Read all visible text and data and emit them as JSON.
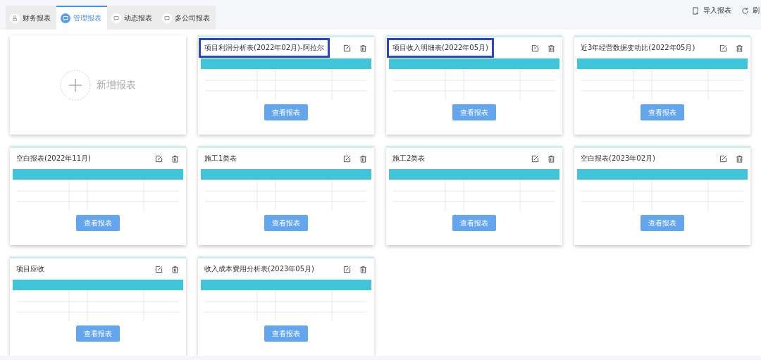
{
  "tabs": [
    {
      "label": "财务报表",
      "selected": false
    },
    {
      "label": "管理报表",
      "selected": true
    },
    {
      "label": "动态报表",
      "selected": false
    },
    {
      "label": "多公司报表",
      "selected": false
    }
  ],
  "toolbar": [
    {
      "kind": "import",
      "label": "导入报表"
    },
    {
      "kind": "refresh",
      "label": "刷"
    }
  ],
  "add_card": {
    "label": "新增报表"
  },
  "reports": [
    {
      "title": "项目利润分析表(2022年02月)-阿拉尔",
      "highlighted": true,
      "button": "查看报表"
    },
    {
      "title": "项目收入明细表(2022年05月)",
      "highlighted": true,
      "button": "查看报表"
    },
    {
      "title": "近3年经营数据变动比(2022年05月)",
      "highlighted": false,
      "button": "查看报表"
    },
    {
      "title": "空白报表(2022年11月)",
      "highlighted": false,
      "button": "查看报表"
    },
    {
      "title": "施工1类表",
      "highlighted": false,
      "button": "查看报表"
    },
    {
      "title": "施工2类表",
      "highlighted": false,
      "button": "查看报表"
    },
    {
      "title": "空白报表(2023年02月)",
      "highlighted": false,
      "button": "查看报表"
    },
    {
      "title": "项目应收",
      "highlighted": false,
      "button": "查看报表"
    },
    {
      "title": "收入成本费用分析表(2023年05月)",
      "highlighted": false,
      "button": "查看报表"
    }
  ]
}
